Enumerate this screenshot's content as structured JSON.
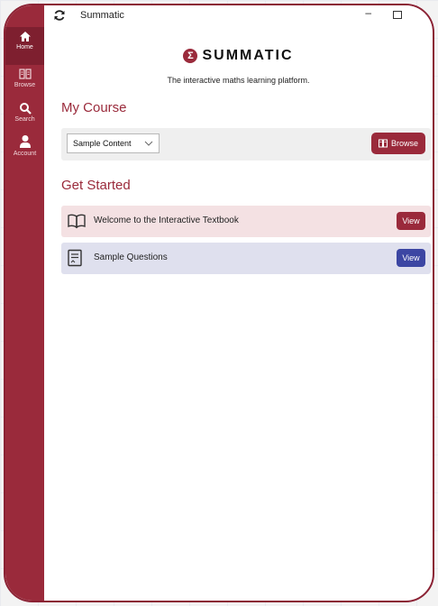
{
  "window": {
    "title": "Summatic",
    "minimize_glyph": "–"
  },
  "sidebar": {
    "items": [
      {
        "label": "Home",
        "icon": "home-icon"
      },
      {
        "label": "Browse",
        "icon": "book-icon"
      },
      {
        "label": "Search",
        "icon": "search-icon"
      },
      {
        "label": "Account",
        "icon": "user-icon"
      }
    ]
  },
  "brand": {
    "logo_glyph": "Σ",
    "name": "SUMMATIC",
    "tagline": "The interactive maths learning platform."
  },
  "my_course": {
    "heading": "My Course",
    "selected_course": "Sample Content",
    "browse_label": "Browse"
  },
  "get_started": {
    "heading": "Get Started",
    "items": [
      {
        "label": "Welcome to the Interactive Textbook",
        "button": "View"
      },
      {
        "label": "Sample Questions",
        "button": "View"
      }
    ]
  },
  "colors": {
    "accent": "#9a2a3b",
    "view_blue": "#3c46a3",
    "pink_row": "#f4e1e3",
    "blue_row": "#dfe0ee"
  }
}
